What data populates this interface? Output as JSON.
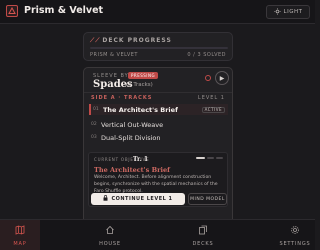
{
  "header": {
    "app_title": "Prism & Velvet",
    "light_label": "LIGHT",
    "light_icon": "sun-icon",
    "logo_icon": "prism-logo-icon"
  },
  "progress": {
    "title": "DECK PROGRESS",
    "deck_name": "PRISM & VELVET",
    "solved_text": "0 / 3 SOLVED",
    "fraction": 0
  },
  "deck": {
    "sleeve_label": "SLEEVE BY",
    "badge": "PRESSING",
    "name": "Spades",
    "tracks_count": "(3 Tracks)",
    "side_label": "SIDE A · TRACKS",
    "level_label": "LEVEL 1",
    "tracks": [
      {
        "num": "01",
        "name": "The Architect's Brief",
        "badge": "ACTIVE"
      },
      {
        "num": "02",
        "name": "Vertical Out-Weave",
        "badge": ""
      },
      {
        "num": "03",
        "name": "Dual-Split Division",
        "badge": ""
      }
    ]
  },
  "objective": {
    "label": "CURRENT OBJECTIVE",
    "track_ref": "Tr. 1",
    "title": "The Architect's Brief",
    "description": "Welcome, Architect. Before alignment construction begins, synchronize with the spatial mechanics of the Faro Shuffle protocol.",
    "continue_label": "CONTINUE LEVEL 1",
    "mind_label": "MIND MODEL"
  },
  "nav": {
    "items": [
      {
        "label": "MAP",
        "icon": "map-icon"
      },
      {
        "label": "HOUSE",
        "icon": "house-icon"
      },
      {
        "label": "DECKS",
        "icon": "decks-icon"
      },
      {
        "label": "SETTINGS",
        "icon": "gear-icon"
      }
    ]
  },
  "colors": {
    "accent": "#c04a48",
    "background": "#1b1a1d",
    "card": "#222124"
  }
}
